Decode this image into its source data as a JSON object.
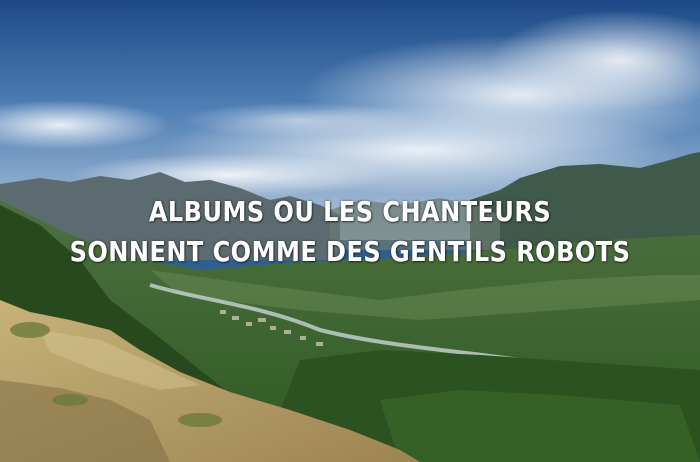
{
  "caption": {
    "line1": "ALBUMS OU LES CHANTEURS",
    "line2": "SONNENT COMME DES GENTILS ROBOTS"
  },
  "colors": {
    "text": "#ffffff",
    "sky_top": "#1f4f8a",
    "sky_mid": "#4f7fb5",
    "forest": "#2f5a25",
    "rock": "#b9a36a"
  }
}
